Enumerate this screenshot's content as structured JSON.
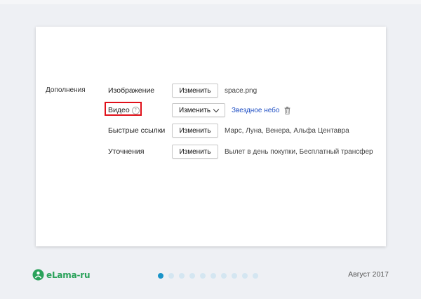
{
  "section": {
    "title": "Дополнения"
  },
  "rows": [
    {
      "label": "Изображение",
      "button": "Изменить",
      "value": "space.png"
    },
    {
      "label": "Видео",
      "button": "Изменить",
      "value": "Звездное небо",
      "has_help": true,
      "has_dropdown": true,
      "has_trash": true,
      "highlighted": true
    },
    {
      "label": "Быстрые ссылки",
      "button": "Изменить",
      "value": "Марс, Луна, Венера, Альфа Центавра"
    },
    {
      "label": "Уточнения",
      "button": "Изменить",
      "value": "Вылет в день покупки, Бесплатный трансфер"
    }
  ],
  "icons": {
    "help": "?",
    "help_icon": "question-circle-icon",
    "trash_icon": "trash-icon",
    "dropdown_icon": "chevron-down-icon",
    "logo_icon": "elama-logo-icon"
  },
  "footer": {
    "logo_text": "eLama-ru",
    "date": "Август 2017",
    "pager": {
      "total": 10,
      "active_index": 0
    }
  },
  "colors": {
    "link": "#1f4fc4",
    "highlight": "#e0101a",
    "brand": "#2aa25a",
    "pager_active": "#1a94c8",
    "pager_inactive": "#d4e6f1"
  }
}
